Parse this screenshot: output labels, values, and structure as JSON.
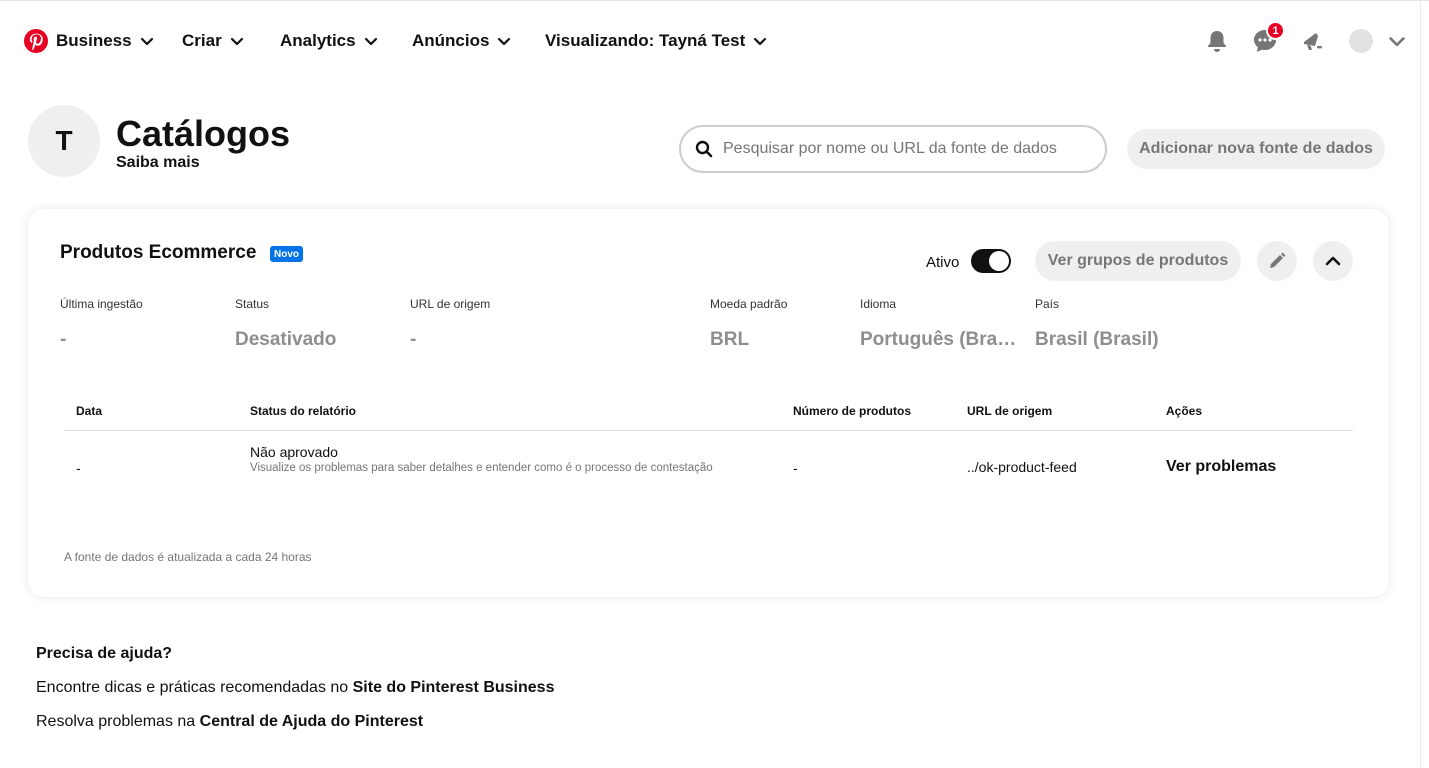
{
  "nav": {
    "business": "Business",
    "create": "Criar",
    "analytics": "Analytics",
    "ads": "Anúncios",
    "viewing": "Visualizando: Tayná Test",
    "messages_badge": "1",
    "brand_color": "#e60023"
  },
  "header": {
    "avatar_letter": "T",
    "title": "Catálogos",
    "learn_more": "Saiba mais",
    "search_placeholder": "Pesquisar por nome ou URL da fonte de dados",
    "add_button": "Adicionar nova fonte de dados"
  },
  "catalog": {
    "name": "Produtos Ecommerce",
    "new_tag": "Novo",
    "active_label": "Ativo",
    "active": true,
    "groups_button": "Ver grupos de produtos",
    "info": {
      "last_ingest_label": "Última ingestão",
      "last_ingest_value": "-",
      "status_label": "Status",
      "status_value": "Desativado",
      "source_url_label": "URL de origem",
      "source_url_value": "-",
      "currency_label": "Moeda padrão",
      "currency_value": "BRL",
      "language_label": "Idioma",
      "language_value": "Português (Brasil)",
      "country_label": "País",
      "country_value": "Brasil (Brasil)"
    },
    "table": {
      "headers": {
        "date": "Data",
        "report_status": "Status do relatório",
        "product_count": "Número de produtos",
        "source_url": "URL de origem",
        "actions": "Ações"
      },
      "rows": [
        {
          "date": "-",
          "status": "Não aprovado",
          "status_detail": "Visualize os problemas para saber detalhes e entender como é o processo de contestação",
          "product_count": "-",
          "source_url": "../ok-product-feed",
          "action": "Ver problemas"
        }
      ]
    },
    "footnote": "A fonte de dados é atualizada a cada 24 horas"
  },
  "help": {
    "title": "Precisa de ajuda?",
    "line1_prefix": "Encontre dicas e práticas recomendadas no ",
    "line1_link": "Site do Pinterest Business",
    "line2_prefix": "Resolva problemas na ",
    "line2_link": "Central de Ajuda do Pinterest"
  }
}
